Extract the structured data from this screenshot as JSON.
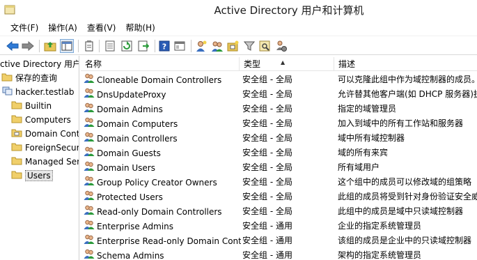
{
  "window": {
    "title": "Active Directory 用户和计算机"
  },
  "menu": [
    {
      "label": "文件(F)"
    },
    {
      "label": "操作(A)"
    },
    {
      "label": "查看(V)"
    },
    {
      "label": "帮助(H)"
    }
  ],
  "toolbar": {
    "icons": [
      "back-icon",
      "forward-icon",
      "up-folder-icon",
      "show-tree-icon",
      "properties-icon",
      "export-list-icon",
      "refresh-icon",
      "run-icon",
      "help-icon",
      "console-icon",
      "new-user-icon",
      "new-group-icon",
      "new-ou-icon",
      "filter-icon",
      "find-icon",
      "add-to-group-icon"
    ]
  },
  "tree": {
    "items": [
      {
        "label": "Active Directory 用户和计算机",
        "icon": "ad-console-icon"
      },
      {
        "label": "保存的查询",
        "icon": "folder-icon"
      },
      {
        "label": "hacker.testlab",
        "icon": "domain-icon"
      },
      {
        "label": "Builtin",
        "icon": "folder-icon"
      },
      {
        "label": "Computers",
        "icon": "folder-icon"
      },
      {
        "label": "Domain Controllers",
        "icon": "ou-icon"
      },
      {
        "label": "ForeignSecurityPrincipals",
        "icon": "folder-icon"
      },
      {
        "label": "Managed Service Accounts",
        "icon": "folder-icon"
      },
      {
        "label": "Users",
        "icon": "folder-icon"
      }
    ]
  },
  "list": {
    "columns": {
      "name": "名称",
      "type": "类型",
      "description": "描述"
    },
    "rows": [
      {
        "name": "Cloneable Domain Controllers",
        "type": "安全组 - 全局",
        "description": "可以克隆此组中作为域控制器的成员。"
      },
      {
        "name": "DnsUpdateProxy",
        "type": "安全组 - 全局",
        "description": "允许替其他客户端(如 DHCP 服务器)执行动态更新的 DNS 客户端。"
      },
      {
        "name": "Domain Admins",
        "type": "安全组 - 全局",
        "description": "指定的域管理员"
      },
      {
        "name": "Domain Computers",
        "type": "安全组 - 全局",
        "description": "加入到域中的所有工作站和服务器"
      },
      {
        "name": "Domain Controllers",
        "type": "安全组 - 全局",
        "description": "域中所有域控制器"
      },
      {
        "name": "Domain Guests",
        "type": "安全组 - 全局",
        "description": "域的所有来宾"
      },
      {
        "name": "Domain Users",
        "type": "安全组 - 全局",
        "description": "所有域用户"
      },
      {
        "name": "Group Policy Creator Owners",
        "type": "安全组 - 全局",
        "description": "这个组中的成员可以修改域的组策略"
      },
      {
        "name": "Protected Users",
        "type": "安全组 - 全局",
        "description": "此组的成员将受到针对身份验证安全威胁的额外保护。"
      },
      {
        "name": "Read-only Domain Controllers",
        "type": "安全组 - 全局",
        "description": "此组中的成员是域中只读域控制器"
      },
      {
        "name": "Enterprise Admins",
        "type": "安全组 - 通用",
        "description": "企业的指定系统管理员"
      },
      {
        "name": "Enterprise Read-only Domain Controllers",
        "type": "安全组 - 通用",
        "description": "该组的成员是企业中的只读域控制器"
      },
      {
        "name": "Schema Admins",
        "type": "安全组 - 通用",
        "description": "架构的指定系统管理员"
      }
    ]
  }
}
